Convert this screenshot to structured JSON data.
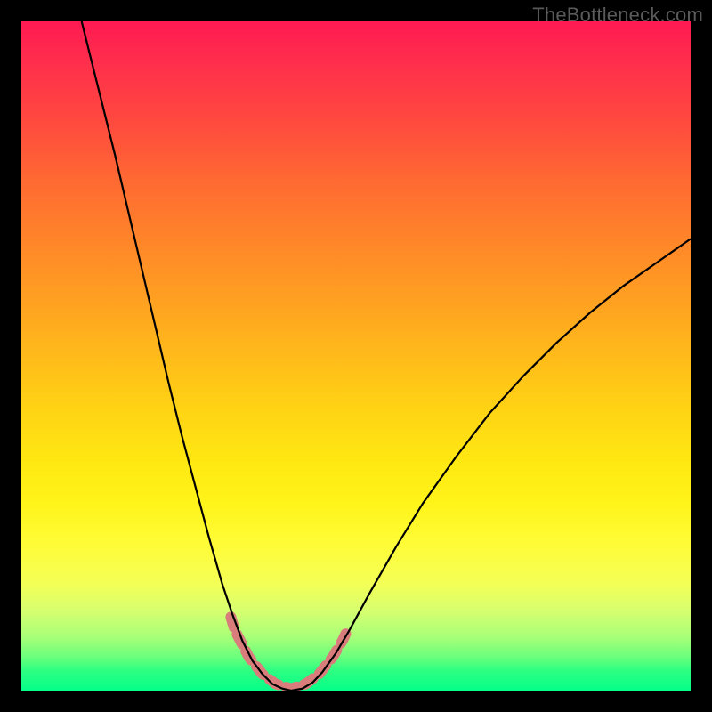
{
  "watermark": "TheBottleneck.com",
  "chart_data": {
    "type": "line",
    "title": "",
    "xlabel": "",
    "ylabel": "",
    "xlim": [
      0,
      100
    ],
    "ylim": [
      0,
      100
    ],
    "grid": false,
    "gradient_stops": [
      {
        "pos": 0,
        "color": "#ff1a52"
      },
      {
        "pos": 6,
        "color": "#ff2e4c"
      },
      {
        "pos": 14,
        "color": "#ff4640"
      },
      {
        "pos": 24,
        "color": "#ff6a32"
      },
      {
        "pos": 36,
        "color": "#ff8f26"
      },
      {
        "pos": 48,
        "color": "#ffb41c"
      },
      {
        "pos": 58,
        "color": "#ffd314"
      },
      {
        "pos": 66,
        "color": "#ffe912"
      },
      {
        "pos": 72,
        "color": "#fff41a"
      },
      {
        "pos": 78,
        "color": "#fffc37"
      },
      {
        "pos": 84,
        "color": "#f4ff56"
      },
      {
        "pos": 88,
        "color": "#d7ff6f"
      },
      {
        "pos": 92,
        "color": "#a8ff78"
      },
      {
        "pos": 95,
        "color": "#6aff7c"
      },
      {
        "pos": 97,
        "color": "#2dff82"
      },
      {
        "pos": 100,
        "color": "#05ff88"
      }
    ],
    "series": [
      {
        "name": "bottleneck-curve",
        "stroke": "#000000",
        "stroke_width": 2,
        "points": [
          {
            "x": 9.0,
            "y": 100.0
          },
          {
            "x": 10.0,
            "y": 96.0
          },
          {
            "x": 12.0,
            "y": 88.0
          },
          {
            "x": 14.0,
            "y": 80.0
          },
          {
            "x": 16.0,
            "y": 71.5
          },
          {
            "x": 18.0,
            "y": 63.0
          },
          {
            "x": 20.0,
            "y": 54.5
          },
          {
            "x": 22.0,
            "y": 46.0
          },
          {
            "x": 24.0,
            "y": 38.0
          },
          {
            "x": 26.0,
            "y": 30.5
          },
          {
            "x": 28.0,
            "y": 23.0
          },
          {
            "x": 30.0,
            "y": 16.0
          },
          {
            "x": 31.5,
            "y": 11.5
          },
          {
            "x": 33.0,
            "y": 7.5
          },
          {
            "x": 34.5,
            "y": 4.5
          },
          {
            "x": 36.0,
            "y": 2.5
          },
          {
            "x": 37.5,
            "y": 1.0
          },
          {
            "x": 39.0,
            "y": 0.3
          },
          {
            "x": 40.3,
            "y": 0.0
          },
          {
            "x": 42.0,
            "y": 0.3
          },
          {
            "x": 43.5,
            "y": 1.2
          },
          {
            "x": 45.0,
            "y": 2.8
          },
          {
            "x": 47.0,
            "y": 5.6
          },
          {
            "x": 49.0,
            "y": 9.0
          },
          {
            "x": 52.0,
            "y": 14.5
          },
          {
            "x": 56.0,
            "y": 21.5
          },
          {
            "x": 60.0,
            "y": 28.0
          },
          {
            "x": 65.0,
            "y": 35.0
          },
          {
            "x": 70.0,
            "y": 41.5
          },
          {
            "x": 75.0,
            "y": 47.0
          },
          {
            "x": 80.0,
            "y": 52.0
          },
          {
            "x": 85.0,
            "y": 56.5
          },
          {
            "x": 90.0,
            "y": 60.5
          },
          {
            "x": 95.0,
            "y": 64.0
          },
          {
            "x": 100.0,
            "y": 67.5
          }
        ]
      },
      {
        "name": "highlight-band",
        "stroke": "#d97c7c",
        "stroke_width": 10,
        "stroke_linecap": "round",
        "dash": "10 8",
        "points": [
          {
            "x": 31.3,
            "y": 11.0
          },
          {
            "x": 31.9,
            "y": 9.0
          },
          {
            "x": 34.0,
            "y": 5.0
          },
          {
            "x": 36.0,
            "y": 2.5
          },
          {
            "x": 38.0,
            "y": 1.0
          },
          {
            "x": 40.3,
            "y": 0.3
          },
          {
            "x": 42.5,
            "y": 1.0
          },
          {
            "x": 44.5,
            "y": 2.5
          },
          {
            "x": 46.5,
            "y": 5.0
          },
          {
            "x": 48.0,
            "y": 7.5
          },
          {
            "x": 48.8,
            "y": 9.2
          }
        ]
      }
    ]
  }
}
